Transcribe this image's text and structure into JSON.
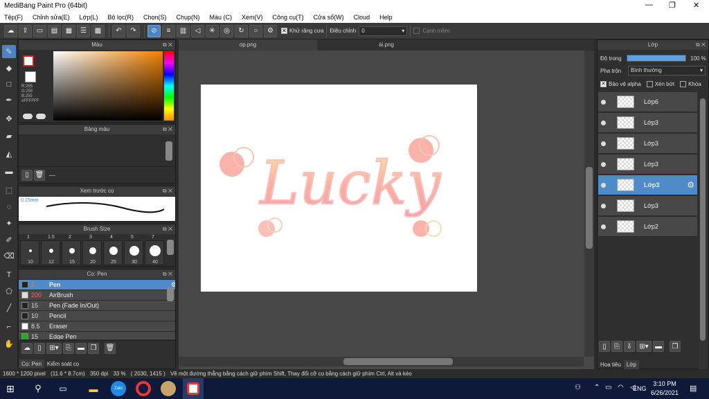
{
  "window": {
    "title": "MediBang Paint Pro (64bit)"
  },
  "menu": [
    "Tệp(F)",
    "Chỉnh sửa(E)",
    "Lớp(L)",
    "Bộ lọc(R)",
    "Chọn(S)",
    "Chụp(N)",
    "Màu (C)",
    "Xem(V)",
    "Công cụ(T)",
    "Cửa sổ(W)",
    "Cloud",
    "Help"
  ],
  "toolbar": {
    "antialias_label": "Khử răng cưa",
    "adjust_label": "Điều chỉnh",
    "adjust_value": "0",
    "edge_label": "Cạnh mềm"
  },
  "color_panel": {
    "title": "Màu",
    "r": "R:255",
    "g": "G:255",
    "b": "B:255",
    "hex": "#FFFFFF",
    "primary_color": "#ffffff",
    "secondary_color": "#ffffff"
  },
  "palette_panel": {
    "title": "Bảng màu",
    "footer": "---"
  },
  "brush_preview": {
    "title": "Xem trước cọ",
    "size_text": "0.15mm"
  },
  "brush_size": {
    "title": "Brush Size",
    "top": [
      "1",
      "1.5",
      "2",
      "3",
      "4",
      "5",
      "7"
    ],
    "bottom": [
      "10",
      "12",
      "15",
      "20",
      "25",
      "30",
      "40"
    ]
  },
  "brush_list": {
    "title": "Cọ: Pen",
    "items": [
      {
        "size": "2",
        "name": "Pen",
        "color": "#222222"
      },
      {
        "size": "200",
        "name": "AirBrush",
        "color": "#dddddd"
      },
      {
        "size": "15",
        "name": "Pen (Fade In/Out)",
        "color": "#222222"
      },
      {
        "size": "10",
        "name": "Pencil",
        "color": "#222222"
      },
      {
        "size": "8.5",
        "name": "Eraser",
        "color": "#ffffff"
      },
      {
        "size": "15",
        "name": "Edge Pen",
        "color": "#22aa22"
      }
    ]
  },
  "bottom_tabs": {
    "left1": "Cọ: Pen",
    "left2": "Kiểm soát cọ",
    "right1": "Hoa tiêu",
    "right2": "Lớp"
  },
  "doc_tabs": [
    "op.png",
    "ài.png"
  ],
  "canvas_text": "Lucky",
  "layers_panel": {
    "title": "Lớp",
    "opacity_label": "Độ trong",
    "opacity_value": "100 %",
    "opacity_fraction": 1.0,
    "blend_label": "Pha trộn",
    "blend_value": "Bình thường",
    "protect_alpha": "Bảo vệ alpha",
    "clip": "Xén bớt",
    "lock": "Khóa",
    "layers": [
      "Lớp6",
      "Lớp3",
      "Lớp3",
      "Lớp3",
      "Lớp3",
      "Lớp3",
      "Lớp2"
    ],
    "selected_index": 4
  },
  "status": {
    "size": "1600 * 1200 pixel",
    "physical": "(11.6 * 8.7cm)",
    "dpi": "350 dpi",
    "zoom": "33 %",
    "coords": "( 2030, 1415 )",
    "hint": "Vẽ một đường thẳng bằng cách giữ phím Shift, Thay đổi cỡ cọ bằng cách giữ phím Ctrl, Alt và kéo"
  },
  "taskbar": {
    "lang": "ENG",
    "time": "3:10 PM",
    "date": "6/26/2021"
  }
}
